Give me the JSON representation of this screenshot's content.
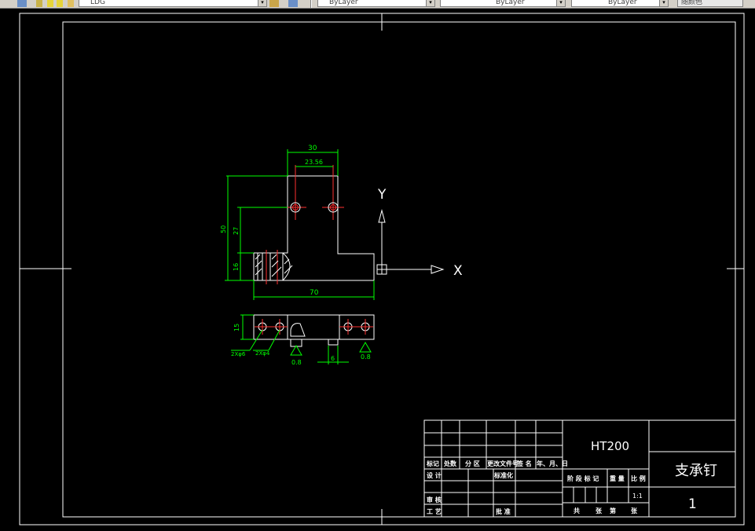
{
  "toolbar": {
    "layer_combo": "LDG",
    "color_combo": "ByLayer",
    "linetype_combo": "ByLayer",
    "lineweight_combo": "ByLayer",
    "plotstyle_combo": "随颜色"
  },
  "drawing": {
    "ucs": {
      "x_label": "X",
      "y_label": "Y"
    },
    "dimensions": {
      "top_width": "30",
      "hole_spacing": "23.56",
      "total_height": "50",
      "upper_height": "27",
      "lower_height": "16",
      "total_width": "70",
      "side_height": "15",
      "hole_left": "2Xφ6",
      "hole_right": "2Xφ4",
      "slot_width": "6",
      "roughness_left": "0.8",
      "roughness_right": "0.8"
    },
    "title_block": {
      "material": "HT200",
      "part_name": "支承钉",
      "drawing_number": "1",
      "scale": "1:1",
      "headers": {
        "mark": "标记",
        "count": "处数",
        "zone": "分 区",
        "change_doc": "更改文件号",
        "signature": "签 名",
        "date": "年、月、日",
        "design": "设 计",
        "standardize": "标准化",
        "review": "审 核",
        "process": "工 艺",
        "approve": "批 准",
        "stage_mark": "阶 段 标 记",
        "weight": "重 量",
        "ratio": "比 例",
        "total": "共",
        "sheets1": "张",
        "page": "第",
        "sheets2": "张"
      }
    }
  }
}
